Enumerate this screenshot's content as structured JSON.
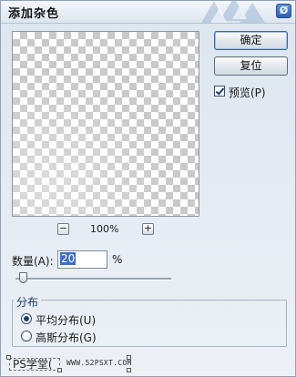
{
  "dialog": {
    "title": "添加杂色",
    "close_glyph": "Ø"
  },
  "preview": {
    "zoom_out_glyph": "−",
    "zoom_in_glyph": "+",
    "zoom_level": "100%"
  },
  "buttons": {
    "ok_label": "确定",
    "reset_label": "复位"
  },
  "preview_toggle": {
    "label": "预览(P)",
    "checked": true
  },
  "amount": {
    "label": "数量(A):",
    "value": "20",
    "unit": "%",
    "slider_fraction": 0.05
  },
  "distribution": {
    "title": "分布",
    "options": [
      {
        "label": "平均分布(U)",
        "selected": true
      },
      {
        "label": "高斯分布(G)",
        "selected": false
      }
    ]
  },
  "watermark": {
    "left_text": "PS学堂(",
    "right_text": "WWW.52PSXT.COM"
  },
  "colors": {
    "accent": "#3f6fc4",
    "dialog_bg": "#e6ecf3",
    "close_button": "#2f5fb0"
  }
}
